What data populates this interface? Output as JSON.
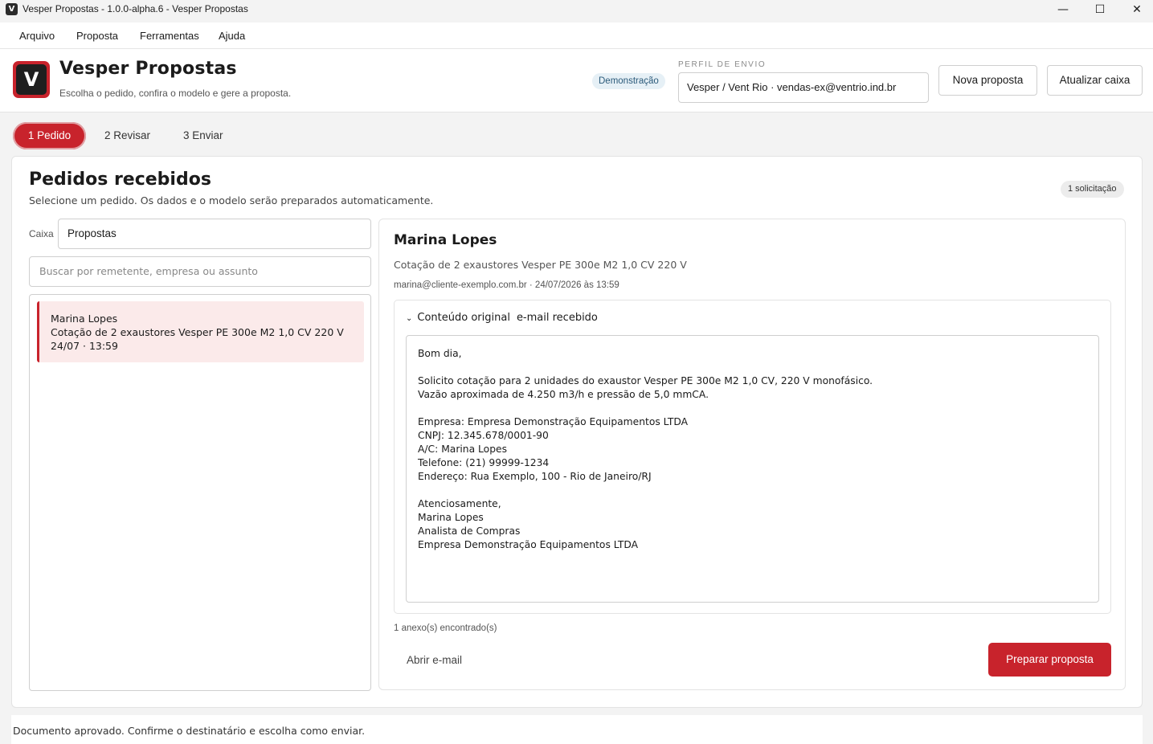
{
  "window": {
    "logo_glyph": "V",
    "title": "Vesper Propostas - 1.0.0-alpha.6 - Vesper Propostas",
    "minimize_glyph": "—",
    "maximize_glyph": "☐",
    "close_glyph": "✕"
  },
  "menu": [
    "Arquivo",
    "Proposta",
    "Ferramentas",
    "Ajuda"
  ],
  "header": {
    "logo_glyph": "V",
    "title": "Vesper Propostas",
    "subtitle": "Escolha o pedido, confira o modelo e gere a proposta.",
    "mode_badge": "Demonstração",
    "profile_label": "PERFIL DE ENVIO",
    "profile_value": "Vesper / Vent Rio · vendas-ex@ventrio.ind.br",
    "new_button": "Nova proposta",
    "refresh_button": "Atualizar caixa"
  },
  "steps": [
    {
      "label": "1  Pedido",
      "active": true
    },
    {
      "label": "2  Revisar",
      "active": false
    },
    {
      "label": "3  Enviar",
      "active": false
    }
  ],
  "main": {
    "title": "Pedidos recebidos",
    "subtitle": "Selecione um pedido. Os dados e o modelo serão preparados automaticamente.",
    "count_badge": "1 solicitação",
    "mailbox_label": "Caixa",
    "mailbox_value": "Propostas",
    "search_placeholder": "Buscar por remetente, empresa ou assunto",
    "messages": [
      {
        "sender": "Marina Lopes",
        "subject": "Cotação de 2 exaustores Vesper PE 300e M2 1,0 CV 220 V",
        "date": "24/07 · 13:59"
      }
    ]
  },
  "detail": {
    "name": "Marina Lopes",
    "subject": "Cotação de 2 exaustores Vesper PE 300e M2 1,0 CV 220 V",
    "meta": "marina@cliente-exemplo.com.br  ·  24/07/2026 às 13:59",
    "original_toggle_glyph": "⌄",
    "original_label": "Conteúdo original",
    "original_tag": "e-mail recebido",
    "body": "Bom dia,\n\nSolicito cotação para 2 unidades do exaustor Vesper PE 300e M2 1,0 CV, 220 V monofásico.\nVazão aproximada de 4.250 m3/h e pressão de 5,0 mmCA.\n\nEmpresa: Empresa Demonstração Equipamentos LTDA\nCNPJ: 12.345.678/0001-90\nA/C: Marina Lopes\nTelefone: (21) 99999-1234\nEndereço: Rua Exemplo, 100 - Rio de Janeiro/RJ\n\nAtenciosamente,\nMarina Lopes\nAnalista de Compras\nEmpresa Demonstração Equipamentos LTDA",
    "attachments": "1 anexo(s) encontrado(s)",
    "open_mail": "Abrir e-mail",
    "prepare": "Preparar proposta"
  },
  "status": "Documento aprovado. Confirme o destinatário e escolha como enviar.",
  "colors": {
    "accent": "#c8232c",
    "selected_row": "#fbeaea",
    "demo_badge_bg": "#e6f0f6"
  }
}
